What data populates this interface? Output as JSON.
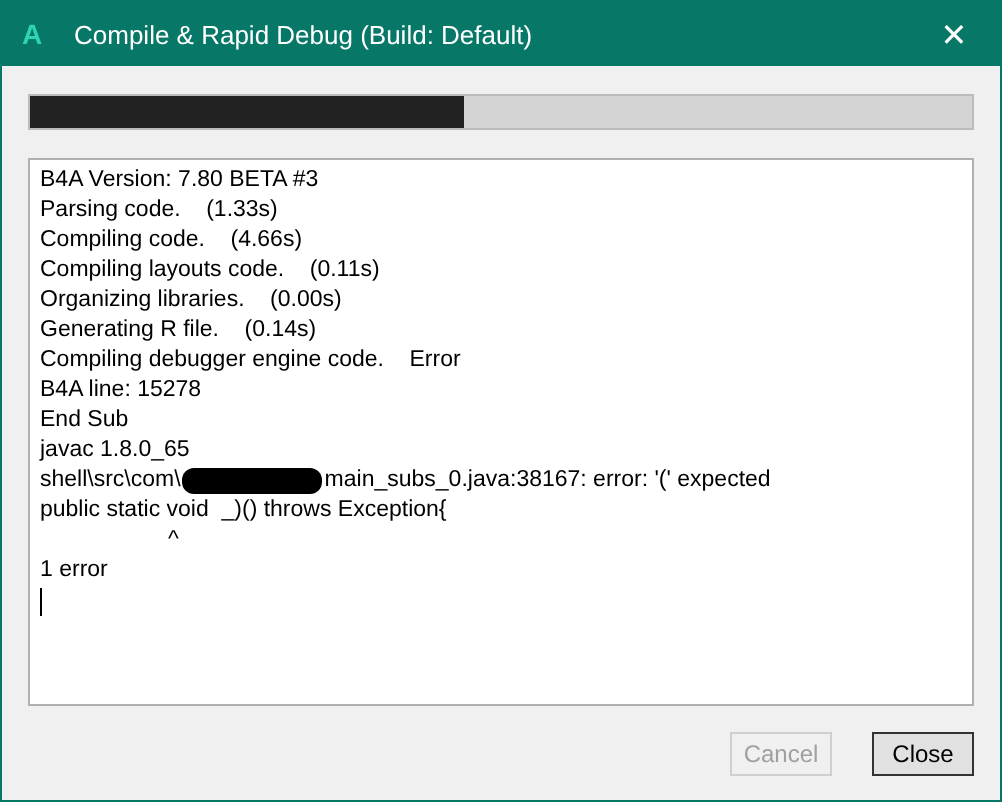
{
  "window": {
    "app_letter": "A",
    "title": "Compile & Rapid Debug (Build: Default)",
    "close": "✕"
  },
  "progress": {
    "level": 0.46
  },
  "log": {
    "lines": [
      {
        "kind": "text",
        "text": "B4A Version: 7.80 BETA #3"
      },
      {
        "kind": "text",
        "text": "Parsing code.    (1.33s)"
      },
      {
        "kind": "text",
        "text": "Compiling code.    (4.66s)"
      },
      {
        "kind": "text",
        "text": "Compiling layouts code.    (0.11s)"
      },
      {
        "kind": "text",
        "text": "Organizing libraries.    (0.00s)"
      },
      {
        "kind": "text",
        "text": "Generating R file.    (0.14s)"
      },
      {
        "kind": "text",
        "text": "Compiling debugger engine code.    Error"
      },
      {
        "kind": "text",
        "text": "B4A line: 15278"
      },
      {
        "kind": "text",
        "text": "End Sub"
      },
      {
        "kind": "text",
        "text": "javac 1.8.0_65"
      },
      {
        "kind": "redacted",
        "before": "shell\\src\\com\\",
        "after": "main_subs_0.java:38167: error: '(' expected"
      },
      {
        "kind": "text",
        "text": "public static void  _)() throws Exception{"
      },
      {
        "kind": "caret",
        "text": "^"
      },
      {
        "kind": "text",
        "text": "1 error"
      }
    ],
    "cursor": true
  },
  "buttons": [
    {
      "label": "Cancel",
      "disabled": true
    },
    {
      "label": "Close",
      "disabled": false
    }
  ]
}
